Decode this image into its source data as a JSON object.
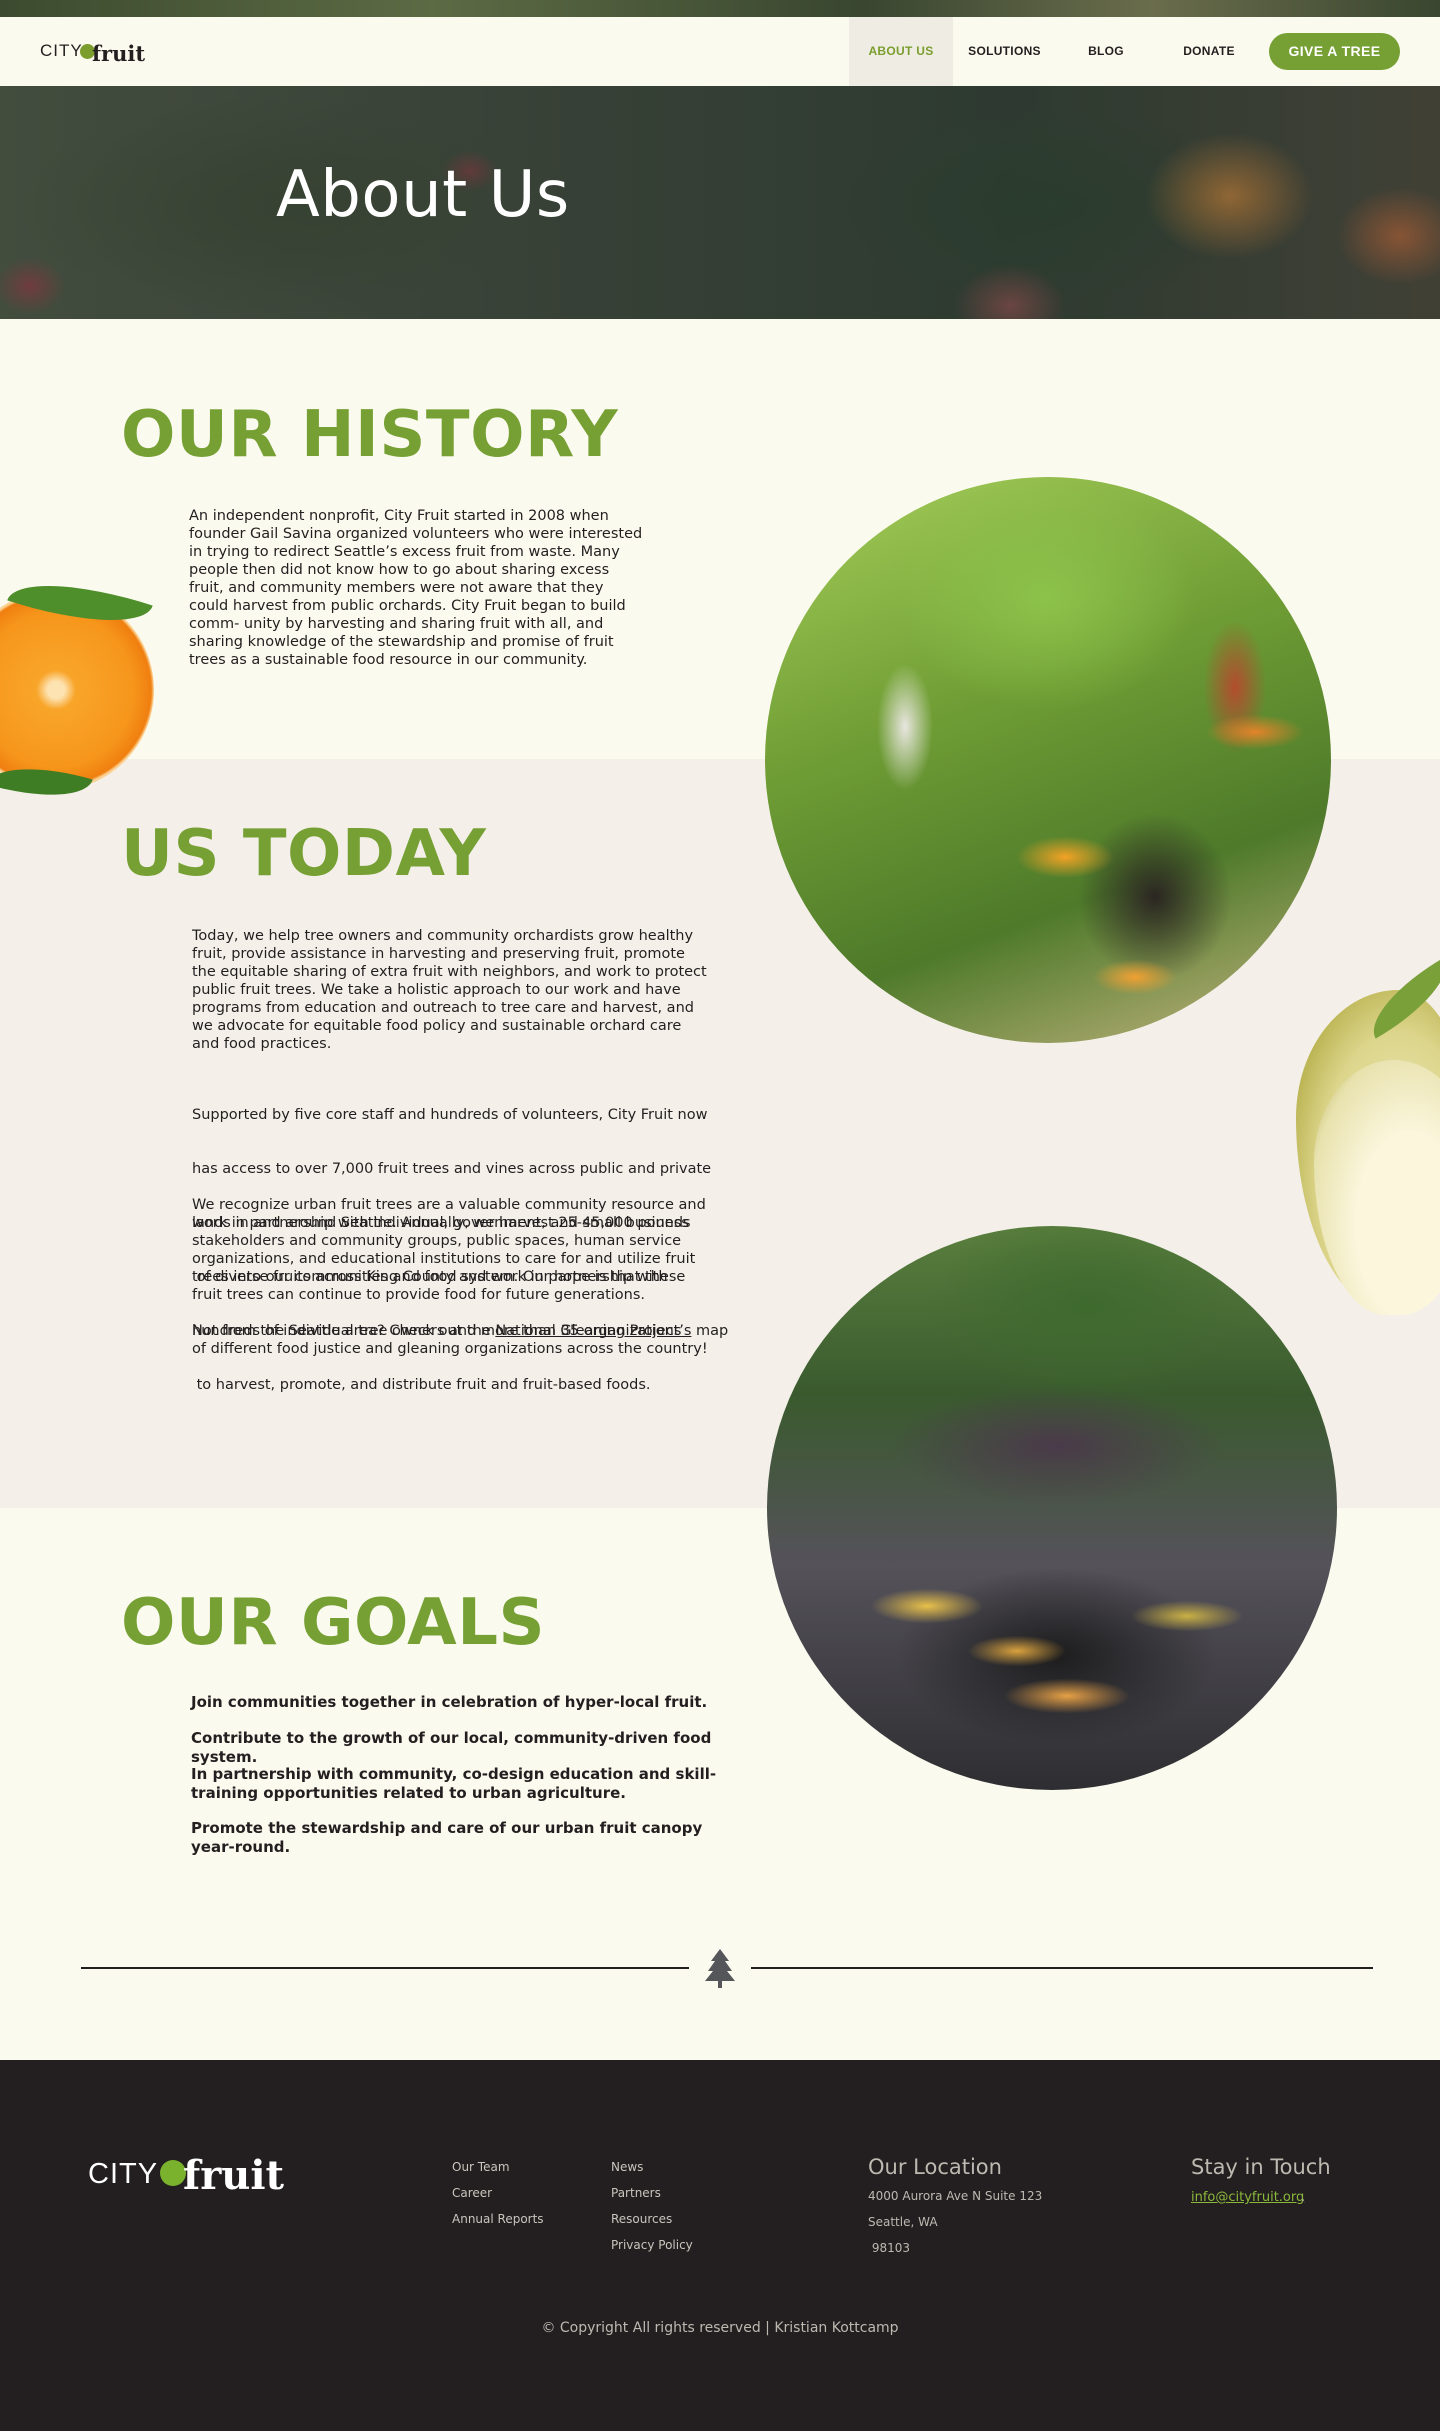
{
  "nav": {
    "logo_city": "CITY",
    "logo_fruit": "fruit",
    "items": [
      "ABOUT US",
      "SOLUTIONS",
      "BLOG",
      "DONATE"
    ],
    "active_item": "ABOUT US",
    "cta": "GIVE A TREE"
  },
  "hero": {
    "title": "About Us"
  },
  "history": {
    "heading": "OUR HISTORY",
    "lines": [
      "An independent nonprofit, City Fruit started in 2008 when",
      "founder Gail Savina organized volunteers who were interested",
      "in trying to redirect Seattle’s excess fruit from waste. Many",
      "people then did not know how to go about sharing excess",
      "fruit, and community members were not aware that they",
      "could harvest from public orchards. City Fruit began to build",
      "comm- unity by harvesting and sharing fruit with all, and",
      "sharing knowledge of the stewardship and promise of fruit",
      "trees as a sustainable food resource in our community."
    ]
  },
  "today": {
    "heading": "US TODAY",
    "p1": [
      "Today, we help tree owners and community orchardists grow healthy",
      "fruit, provide assistance in harvesting and preserving fruit, promote",
      "the equitable sharing of extra fruit with neighbors, and work to protect",
      "public fruit trees. We take a holistic approach to our work and have",
      "programs from education and outreach to tree care and harvest, and",
      "we advocate for equitable food policy and sustainable orchard care",
      "and food practices."
    ],
    "p2": [
      "Supported by five core staff and hundreds of volunteers, City Fruit now",
      "has access to over 7,000 fruit trees and vines across public and private",
      "lands in and around Seattle. Annually, we harvest 25-45,000 pounds",
      " of diverse fruits across King County and work in partnership with",
      "hundreds of individual tree owners and more than 35 organizations",
      " to harvest, promote, and distribute fruit and fruit-based foods."
    ],
    "p3": [
      "We recognize urban fruit trees are a valuable community resource and",
      "work in partnership with individual, government, and small business",
      "stakeholders and community groups, public spaces, human service",
      "organizations, and educational institutions to care for and utilize fruit",
      "trees into our communities and food system. Our hope is that these",
      "fruit trees can continue to provide food for future generations."
    ],
    "p4_before": "Not from the Seattle area? Check out the ",
    "p4_link": "National Gleaning Project’s",
    "p4_after": " map",
    "p4_line2": "of different food justice and gleaning organizations across the country!"
  },
  "goals": {
    "heading": "OUR GOALS",
    "items": [
      [
        "Join communities together in celebration of hyper-local fruit."
      ],
      [
        "Contribute to the growth of our local, community-driven food system."
      ],
      [
        "In partnership with community, co-design education and skill-",
        "training opportunities related to urban agriculture."
      ],
      [
        "Promote the stewardship and care of our urban fruit canopy",
        "year-round."
      ]
    ]
  },
  "icons": {
    "divider": "tree-icon",
    "logo_mark": "apple-icon"
  },
  "colors": {
    "brand_green": "#76a034",
    "footer_bg": "#231f20",
    "cream": "#fbfaee",
    "band": "#f4f0e9"
  },
  "footer": {
    "logo_city": "CITY",
    "logo_fruit": "fruit",
    "col1": [
      "Our Team",
      "Career",
      "Annual Reports"
    ],
    "col2": [
      "News",
      "Partners",
      "Resources",
      "Privacy Policy"
    ],
    "location_heading": "Our Location",
    "location_lines": [
      "4000 Aurora Ave N Suite 123",
      "Seattle, WA",
      " 98103"
    ],
    "contact_heading": "Stay in Touch",
    "email": "info@cityfruit.org",
    "email_suffix": ".",
    "copyright": "© Copyright All rights reserved | Kristian Kottcamp"
  }
}
